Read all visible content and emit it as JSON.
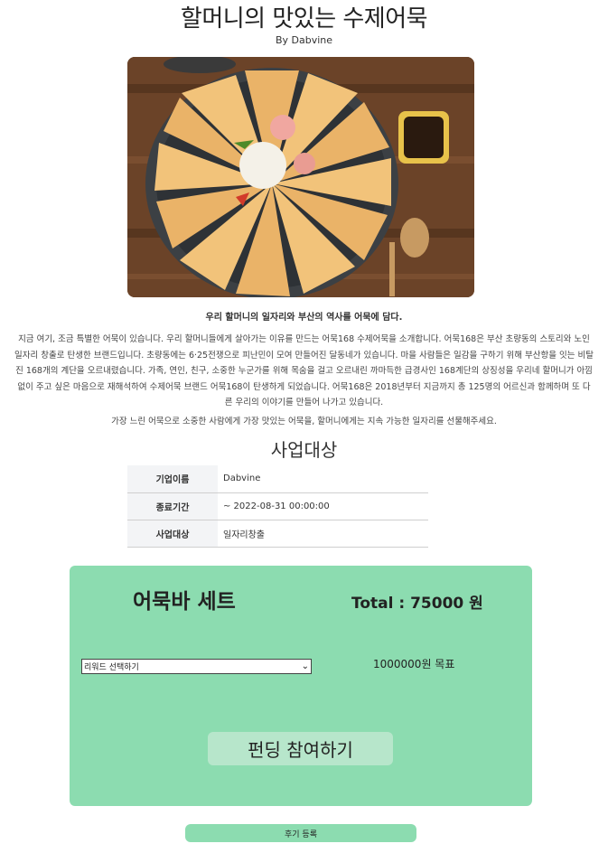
{
  "page": {
    "title": "할머니의 맛있는 수제어묵",
    "author": "By Dabvine",
    "subtitle": "우리 할머니의 일자리와 부산의 역사를 어묵에 담다.",
    "description": "지금 여기, 조금 특별한 어묵이 있습니다. 우리 할머니들에게 살아가는 이유를 만드는 어묵168 수제어묵을 소개합니다. 어묵168은 부산 초량동의 스토리와 노인 일자리 창출로 탄생한 브랜드입니다. 초량동에는 6·25전쟁으로 피난민이 모여 만들어진 달동네가 있습니다. 마을 사람들은 일감을 구하기 위해 부산항을 잇는 비탈진 168개의 계단을 오르내렸습니다. 가족, 연인, 친구, 소중한 누군가를 위해 목숨을 걸고 오르내린 까마득한 급경사인 168계단의 상징성을 우리네 할머니가 아낌없이 주고 싶은 마음으로 재해석하여 수제어묵 브랜드 어묵168이 탄생하게 되었습니다. 어묵168은 2018년부터 지금까지 총 125명의 어르신과 함께하며 또 다른 우리의 이야기를 만들어 나가고 있습니다.",
    "description2": "가장 느린 어묵으로 소중한 사람에게 가장 맛있는 어묵을, 할머니에게는 지속 가능한 일자리를 선물해주세요."
  },
  "business": {
    "section_title": "사업대상",
    "rows": [
      {
        "key": "기업이름",
        "value": "Dabvine"
      },
      {
        "key": "종료기간",
        "value": "~ 2022-08-31 00:00:00"
      },
      {
        "key": "사업대상",
        "value": "일자리창출"
      }
    ]
  },
  "card": {
    "name": "어묵바 세트",
    "total": "Total : 75000 원",
    "reward_select": "리워드 선택하기",
    "goal": "1000000원 목표",
    "fund_button": "펀딩 참여하기",
    "color": "#8cdcb0"
  },
  "review_button": "후기 등록"
}
